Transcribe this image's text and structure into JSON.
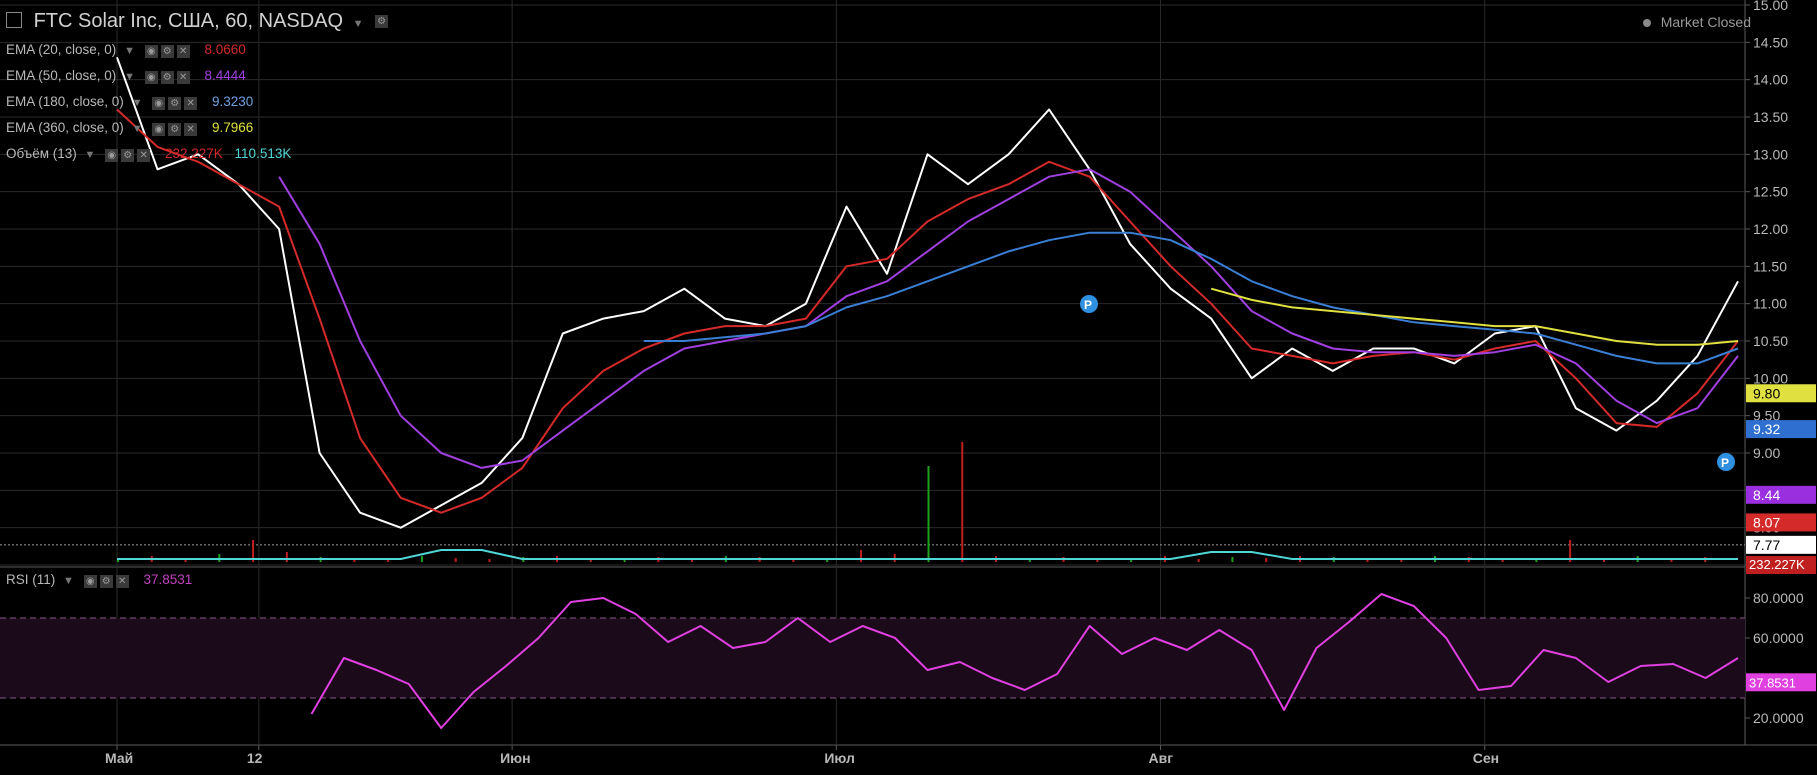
{
  "header": {
    "title": "FTC Solar Inc, США, 60, NASDAQ",
    "market_status": "Market Closed"
  },
  "legend": [
    {
      "label": "EMA (20, close, 0)",
      "value": "8.0660",
      "color": "#d42a2a"
    },
    {
      "label": "EMA (50, close, 0)",
      "value": "8.4444",
      "color": "#a040e0"
    },
    {
      "label": "EMA (180, close, 0)",
      "value": "9.3230",
      "color": "#3a7fd4"
    },
    {
      "label": "EMA (360, close, 0)",
      "value": "9.7966",
      "color": "#e0e040"
    },
    {
      "label": "Объём (13)",
      "value": "232.227K",
      "value2": "110.513K",
      "color": "#d42a2a",
      "color2": "#4fd7d7"
    }
  ],
  "rsi": {
    "label": "RSI (11)",
    "value": "37.8531",
    "color": "#e040e0"
  },
  "chart_data": [
    {
      "type": "line",
      "title": "FTC Solar Inc, США, 60, NASDAQ",
      "x": [
        0,
        4,
        8,
        12,
        16,
        20,
        24,
        28,
        32,
        36,
        40,
        44,
        48,
        52,
        56,
        60,
        64,
        68,
        72,
        76,
        80,
        84,
        88,
        92,
        96,
        100,
        104,
        108,
        112,
        116,
        120,
        124,
        128,
        132,
        136,
        140,
        144,
        148,
        152,
        156,
        160
      ],
      "x_ticks": [
        {
          "label": "Май",
          "x": 0
        },
        {
          "label": "12",
          "x": 14
        },
        {
          "label": "Июн",
          "x": 39
        },
        {
          "label": "Июл",
          "x": 71
        },
        {
          "label": "Авг",
          "x": 103
        },
        {
          "label": "Сен",
          "x": 135
        }
      ],
      "ylim": [
        7.5,
        15.0
      ],
      "y_ticks": [
        15.0,
        14.5,
        14.0,
        13.5,
        13.0,
        12.5,
        12.0,
        11.5,
        11.0,
        10.5,
        10.0,
        9.5,
        9.0,
        8.5,
        8.0,
        7.5
      ],
      "series": [
        {
          "name": "FTC Solar Inc",
          "color": "#ffffff",
          "values": [
            14.3,
            12.8,
            13.0,
            12.6,
            12.0,
            9.0,
            8.2,
            8.0,
            8.3,
            8.6,
            9.2,
            10.6,
            10.8,
            10.9,
            11.2,
            10.8,
            10.7,
            11.0,
            12.3,
            11.4,
            13.0,
            12.6,
            13.0,
            13.6,
            12.8,
            11.8,
            11.2,
            10.8,
            10.0,
            10.4,
            10.1,
            10.4,
            10.4,
            10.2,
            10.6,
            10.7,
            9.6,
            9.3,
            9.7,
            10.3,
            11.3
          ]
        },
        {
          "name": "EMA (20, close, 0)",
          "color": "#d42a2a",
          "values": [
            13.6,
            13.1,
            12.9,
            12.6,
            12.3,
            10.8,
            9.2,
            8.4,
            8.2,
            8.4,
            8.8,
            9.6,
            10.1,
            10.4,
            10.6,
            10.7,
            10.7,
            10.8,
            11.5,
            11.6,
            12.1,
            12.4,
            12.6,
            12.9,
            12.7,
            12.1,
            11.5,
            11.0,
            10.4,
            10.3,
            10.2,
            10.3,
            10.35,
            10.25,
            10.4,
            10.5,
            10.0,
            9.4,
            9.35,
            9.8,
            10.5
          ]
        },
        {
          "name": "EMA (50, close, 0)",
          "color": "#a040e0",
          "values": [
            null,
            null,
            null,
            null,
            12.7,
            11.8,
            10.5,
            9.5,
            9.0,
            8.8,
            8.9,
            9.3,
            9.7,
            10.1,
            10.4,
            10.5,
            10.6,
            10.7,
            11.1,
            11.3,
            11.7,
            12.1,
            12.4,
            12.7,
            12.8,
            12.5,
            12.0,
            11.5,
            10.9,
            10.6,
            10.4,
            10.35,
            10.35,
            10.3,
            10.35,
            10.45,
            10.2,
            9.7,
            9.4,
            9.6,
            10.3
          ]
        },
        {
          "name": "EMA (180, close, 0)",
          "color": "#3a7fd4",
          "values": [
            null,
            null,
            null,
            null,
            null,
            null,
            null,
            null,
            null,
            null,
            null,
            null,
            null,
            10.5,
            10.5,
            10.55,
            10.6,
            10.7,
            10.95,
            11.1,
            11.3,
            11.5,
            11.7,
            11.85,
            11.95,
            11.95,
            11.85,
            11.6,
            11.3,
            11.1,
            10.95,
            10.85,
            10.75,
            10.7,
            10.65,
            10.6,
            10.45,
            10.3,
            10.2,
            10.2,
            10.4
          ]
        },
        {
          "name": "EMA (360, close, 0)",
          "color": "#e0e040",
          "values": [
            null,
            null,
            null,
            null,
            null,
            null,
            null,
            null,
            null,
            null,
            null,
            null,
            null,
            null,
            null,
            null,
            null,
            null,
            null,
            null,
            null,
            null,
            null,
            null,
            null,
            null,
            null,
            11.2,
            11.05,
            10.95,
            10.9,
            10.85,
            10.8,
            10.75,
            10.7,
            10.7,
            10.6,
            10.5,
            10.45,
            10.45,
            10.5
          ]
        }
      ],
      "price_tags": [
        {
          "label": "9.80",
          "value": 9.8,
          "color": "#e0e040",
          "text_color": "#000000"
        },
        {
          "label": "9.32",
          "value": 9.32,
          "color": "#2f6fd0",
          "text_color": "#ffffff"
        },
        {
          "label": "8.44",
          "value": 8.44,
          "color": "#9a2fe0",
          "text_color": "#ffffff"
        },
        {
          "label": "8.07",
          "value": 8.07,
          "color": "#d42a2a",
          "text_color": "#ffffff"
        },
        {
          "label": "7.77",
          "value": 7.77,
          "color": "#ffffff",
          "text_color": "#000000"
        }
      ]
    },
    {
      "type": "line",
      "title": "RSI (11)",
      "ylim": [
        8,
        88
      ],
      "y_ticks": [
        80.0,
        60.0,
        20.0
      ],
      "levels": [
        70,
        30
      ],
      "series": [
        {
          "name": "RSI (11)",
          "color": "#e040e0",
          "values": [
            null,
            null,
            null,
            null,
            null,
            null,
            22,
            50,
            44,
            37,
            15,
            33,
            46,
            60,
            78,
            80,
            72,
            58,
            66,
            55,
            58,
            70,
            58,
            66,
            60,
            44,
            48,
            40,
            34,
            42,
            66,
            52,
            60,
            54,
            64,
            54,
            24,
            55,
            68,
            82,
            76,
            60,
            34,
            36,
            54,
            50,
            38,
            46,
            47,
            40,
            50
          ]
        }
      ],
      "x_ticks": [
        {
          "label": "Май",
          "x": 0
        },
        {
          "label": "12",
          "x": 14
        },
        {
          "label": "Июн",
          "x": 39
        },
        {
          "label": "Июл",
          "x": 71
        },
        {
          "label": "Авг",
          "x": 103
        },
        {
          "label": "Сен",
          "x": 135
        }
      ],
      "last_value": "37.8531"
    }
  ],
  "volume": {
    "label": "Объём (13)",
    "tag": "232.227K"
  }
}
